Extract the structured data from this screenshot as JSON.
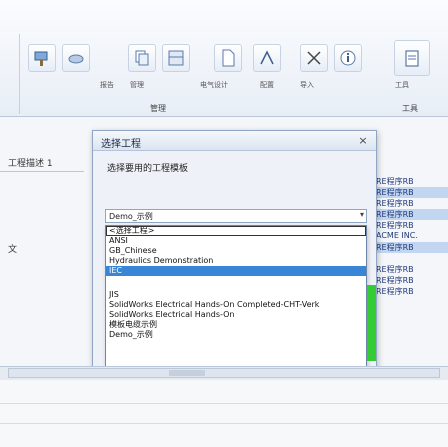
{
  "ribbon": {
    "group_label_1": "管理",
    "group_label_2": "工具",
    "small_labels": [
      "报告",
      "管理",
      "电气设计",
      "配置",
      "导入",
      "工具"
    ],
    "icons": [
      "paint-icon",
      "cloud-icon",
      "copy-icon",
      "panel-icon",
      "cut-icon",
      "wire-icon",
      "file-icon",
      "clipboard-icon"
    ]
  },
  "left": {
    "tab_label": "工程描述 1",
    "item_1": "文",
    "item_2": ""
  },
  "background_list": {
    "rows": [
      {
        "text": "RE程序RB",
        "selected": false
      },
      {
        "text": "RE程序RB",
        "selected": true
      },
      {
        "text": "RE程序RB",
        "selected": false
      },
      {
        "text": "RE程序RB",
        "selected": true
      },
      {
        "text": "RE程序RB",
        "selected": false
      },
      {
        "text": "ACME INC.",
        "selected": false
      },
      {
        "text": "RE程序RB",
        "selected": true
      },
      {
        "text": "",
        "selected": false
      },
      {
        "text": "RE程序RB",
        "selected": false
      },
      {
        "text": "RE程序RB",
        "selected": false
      },
      {
        "text": "RE程序RB",
        "selected": false
      }
    ]
  },
  "dialog": {
    "title": "选择工程",
    "subtitle": "选择要用的工程模板",
    "combo_value": "Demo_示例",
    "close_glyph": "×",
    "dropdown_items": [
      {
        "text": "<选择工程>",
        "highlight": false,
        "boxed": true
      },
      {
        "text": "ANSI",
        "highlight": false,
        "boxed": false
      },
      {
        "text": "GB_Chinese",
        "highlight": false,
        "boxed": false
      },
      {
        "text": "Hydraulics Demonstration",
        "highlight": false,
        "boxed": false
      },
      {
        "text": "IEC",
        "highlight": true,
        "boxed": false
      },
      {
        "text": "JIS",
        "highlight": false,
        "boxed": false
      },
      {
        "text": "SolidWorks Electrical Hands-On Completed-CHT-Verk",
        "highlight": false,
        "boxed": false
      },
      {
        "text": "SolidWorks Electrical Hands-On",
        "highlight": false,
        "boxed": false
      },
      {
        "text": "模板电缆示例",
        "highlight": false,
        "boxed": false
      },
      {
        "text": "Demo_示例",
        "highlight": false,
        "boxed": false
      }
    ]
  },
  "colors": {
    "accent": "#3a86d6",
    "progress": "#33cc33"
  }
}
